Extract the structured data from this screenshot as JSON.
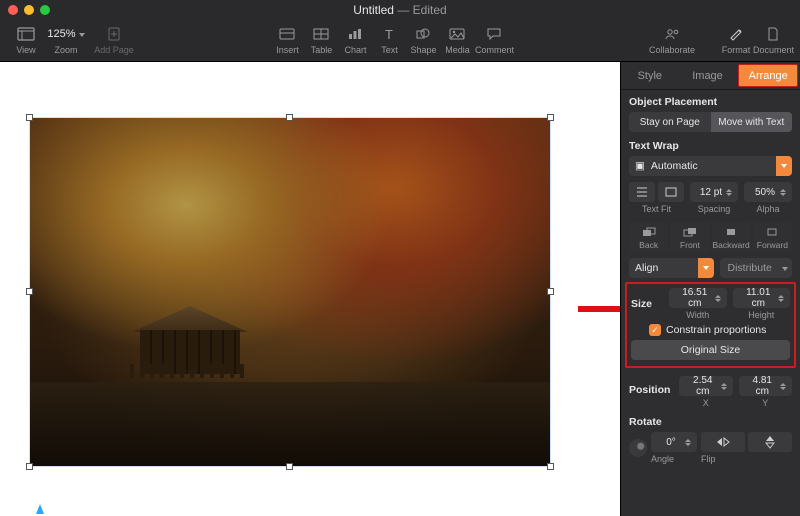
{
  "window": {
    "title": "Untitled",
    "status": "Edited"
  },
  "toolbar": {
    "view": "View",
    "zoom_label": "Zoom",
    "zoom_value": "125%",
    "add_page": "Add Page",
    "insert": "Insert",
    "table": "Table",
    "chart": "Chart",
    "text": "Text",
    "shape": "Shape",
    "media": "Media",
    "comment": "Comment",
    "collaborate": "Collaborate",
    "format": "Format",
    "document": "Document"
  },
  "inspector": {
    "tabs": {
      "style": "Style",
      "image": "Image",
      "arrange": "Arrange"
    },
    "placement": {
      "heading": "Object Placement",
      "stay": "Stay on Page",
      "move": "Move with Text"
    },
    "wrap": {
      "heading": "Text Wrap",
      "mode": "Automatic",
      "text_fit": "Text Fit",
      "spacing_label": "Spacing",
      "spacing_value": "12 pt",
      "alpha_label": "Alpha",
      "alpha_value": "50%"
    },
    "arrange_depth": {
      "back": "Back",
      "front": "Front",
      "backward": "Backward",
      "forward": "Forward"
    },
    "align": {
      "label": "Align",
      "distribute": "Distribute"
    },
    "size": {
      "heading": "Size",
      "width_value": "16.51 cm",
      "width_label": "Width",
      "height_value": "11.01 cm",
      "height_label": "Height",
      "constrain": "Constrain proportions",
      "original": "Original Size"
    },
    "position": {
      "heading": "Position",
      "x_value": "2.54 cm",
      "x_label": "X",
      "y_value": "4.81 cm",
      "y_label": "Y"
    },
    "rotate": {
      "heading": "Rotate",
      "angle_value": "0°",
      "angle_label": "Angle",
      "flip_label": "Flip"
    }
  }
}
